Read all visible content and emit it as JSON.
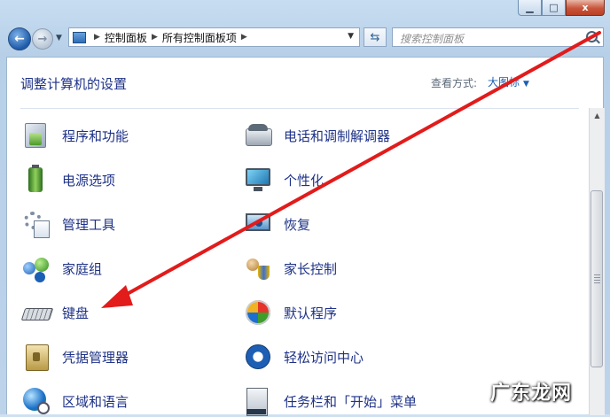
{
  "window": {
    "minimize_icon": "minimize-icon",
    "maximize_icon": "maximize-icon",
    "close_icon": "close-icon",
    "close_label": "x"
  },
  "nav": {
    "back_icon": "back-arrow-icon",
    "forward_icon": "forward-arrow-icon",
    "back_glyph": "←",
    "forward_glyph": "→"
  },
  "address": {
    "crumbs": [
      "控制面板",
      "所有控制面板项"
    ]
  },
  "search": {
    "placeholder": "搜索控制面板"
  },
  "header": {
    "title": "调整计算机的设置",
    "view_by_label": "查看方式:",
    "view_by_value": "大图标"
  },
  "items": {
    "left": [
      {
        "label": "程序和功能",
        "icon": "programs-features-icon"
      },
      {
        "label": "电源选项",
        "icon": "power-options-icon"
      },
      {
        "label": "管理工具",
        "icon": "administrative-tools-icon"
      },
      {
        "label": "家庭组",
        "icon": "homegroup-icon"
      },
      {
        "label": "键盘",
        "icon": "keyboard-icon"
      },
      {
        "label": "凭据管理器",
        "icon": "credential-manager-icon"
      },
      {
        "label": "区域和语言",
        "icon": "region-language-icon"
      }
    ],
    "right": [
      {
        "label": "电话和调制解调器",
        "icon": "phone-modem-icon"
      },
      {
        "label": "个性化",
        "icon": "personalization-icon"
      },
      {
        "label": "恢复",
        "icon": "recovery-icon"
      },
      {
        "label": "家长控制",
        "icon": "parental-controls-icon"
      },
      {
        "label": "默认程序",
        "icon": "default-programs-icon"
      },
      {
        "label": "轻松访问中心",
        "icon": "ease-of-access-icon"
      },
      {
        "label": "任务栏和「开始」菜单",
        "icon": "taskbar-start-menu-icon"
      }
    ]
  },
  "annotation": {
    "color": "#e21b1b"
  },
  "watermark": {
    "text": "广东龙网"
  }
}
